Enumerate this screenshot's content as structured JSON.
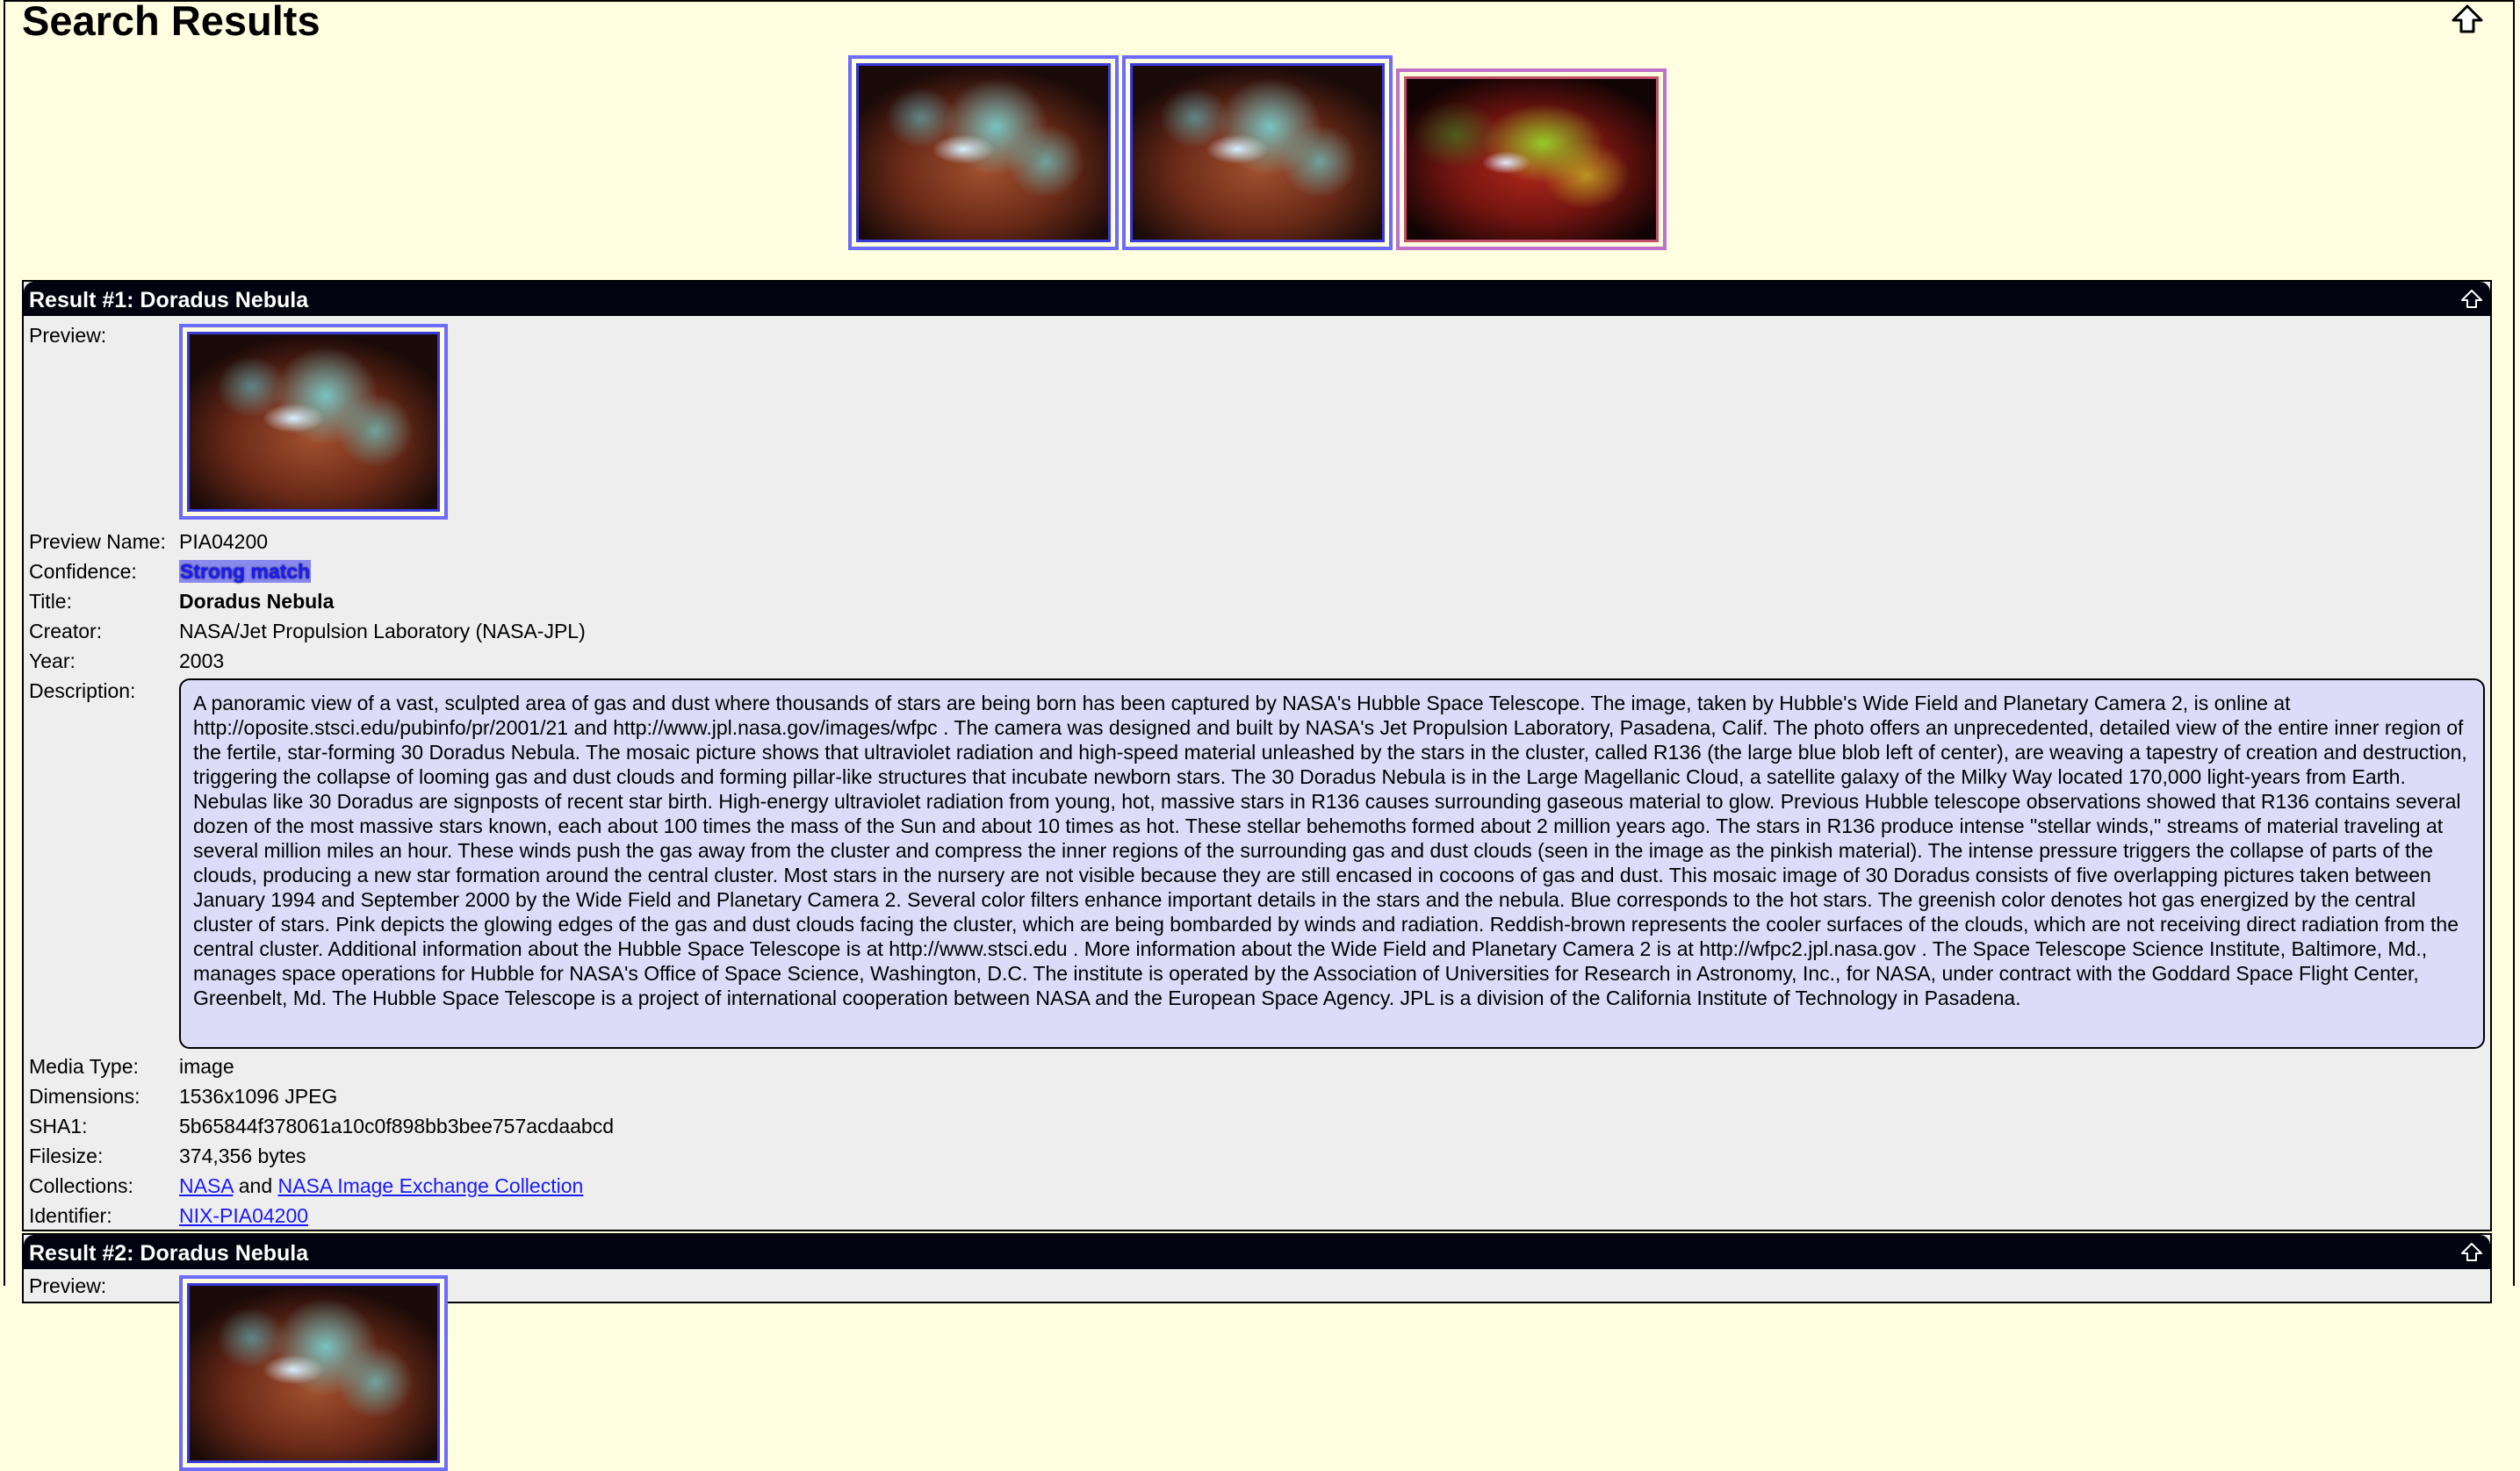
{
  "page": {
    "title": "Search Results"
  },
  "thumbnails": [
    {
      "icon": "nebula-thumbnail",
      "style": "blue"
    },
    {
      "icon": "nebula-thumbnail",
      "style": "blue"
    },
    {
      "icon": "nebula-thumbnail-alt",
      "style": "pink"
    }
  ],
  "result1": {
    "header": "Result #1: Doradus Nebula",
    "labels": {
      "preview": "Preview:",
      "preview_name": "Preview Name:",
      "confidence": "Confidence:",
      "title": "Title:",
      "creator": "Creator:",
      "year": "Year:",
      "description": "Description:",
      "media_type": "Media Type:",
      "dimensions": "Dimensions:",
      "sha1": "SHA1:",
      "filesize": "Filesize:",
      "collections": "Collections:",
      "identifier": "Identifier:"
    },
    "preview_name": "PIA04200",
    "confidence": "Strong match",
    "title": "Doradus Nebula",
    "creator": "NASA/Jet Propulsion Laboratory (NASA-JPL)",
    "year": "2003",
    "description": "A panoramic view of a vast, sculpted area of gas and dust where thousands of stars are being born has been captured by NASA's Hubble Space Telescope. The image, taken by Hubble's Wide Field and Planetary Camera 2, is online at http://oposite.stsci.edu/pubinfo/pr/2001/21 and http://www.jpl.nasa.gov/images/wfpc . The camera was designed and built by NASA's Jet Propulsion Laboratory, Pasadena, Calif. The photo offers an unprecedented, detailed view of the entire inner region of the fertile, star-forming 30 Doradus Nebula. The mosaic picture shows that ultraviolet radiation and high-speed material unleashed by the stars in the cluster, called R136 (the large blue blob left of center), are weaving a tapestry of creation and destruction, triggering the collapse of looming gas and dust clouds and forming pillar-like structures that incubate newborn stars. The 30 Doradus Nebula is in the Large Magellanic Cloud, a satellite galaxy of the Milky Way located 170,000 light-years from Earth. Nebulas like 30 Doradus are signposts of recent star birth. High-energy ultraviolet radiation from young, hot, massive stars in R136 causes surrounding gaseous material to glow. Previous Hubble telescope observations showed that R136 contains several dozen of the most massive stars known, each about 100 times the mass of the Sun and about 10 times as hot. These stellar behemoths formed about 2 million years ago. The stars in R136 produce intense \"stellar winds,\" streams of material traveling at several million miles an hour. These winds push the gas away from the cluster and compress the inner regions of the surrounding gas and dust clouds (seen in the image as the pinkish material). The intense pressure triggers the collapse of parts of the clouds, producing a new star formation around the central cluster. Most stars in the nursery are not visible because they are still encased in cocoons of gas and dust. This mosaic image of 30 Doradus consists of five overlapping pictures taken between January 1994 and September 2000 by the Wide Field and Planetary Camera 2. Several color filters enhance important details in the stars and the nebula. Blue corresponds to the hot stars. The greenish color denotes hot gas energized by the central cluster of stars. Pink depicts the glowing edges of the gas and dust clouds facing the cluster, which are being bombarded by winds and radiation. Reddish-brown represents the cooler surfaces of the clouds, which are not receiving direct radiation from the central cluster. Additional information about the Hubble Space Telescope is at http://www.stsci.edu . More information about the Wide Field and Planetary Camera 2 is at http://wfpc2.jpl.nasa.gov . The Space Telescope Science Institute, Baltimore, Md., manages space operations for Hubble for NASA's Office of Space Science, Washington, D.C. The institute is operated by the Association of Universities for Research in Astronomy, Inc., for NASA, under contract with the Goddard Space Flight Center, Greenbelt, Md. The Hubble Space Telescope is a project of international cooperation between NASA and the European Space Agency. JPL is a division of the California Institute of Technology in Pasadena.",
    "media_type": "image",
    "dimensions": "1536x1096 JPEG",
    "sha1": "5b65844f378061a10c0f898bb3bee757acdaabcd",
    "filesize": "374,356 bytes",
    "collections": {
      "link1": "NASA",
      "joiner": " and ",
      "link2": "NASA Image Exchange Collection"
    },
    "identifier": "NIX-PIA04200"
  },
  "result2": {
    "header": "Result #2: Doradus Nebula",
    "preview_label": "Preview:"
  },
  "colors": {
    "page_bg": "#fffee0",
    "header_bg": "#020210",
    "panel_bg": "#eeeeee",
    "desc_bg": "#dcdcf8",
    "link": "#1a1aff",
    "thumb_border": "#6b6bff"
  }
}
